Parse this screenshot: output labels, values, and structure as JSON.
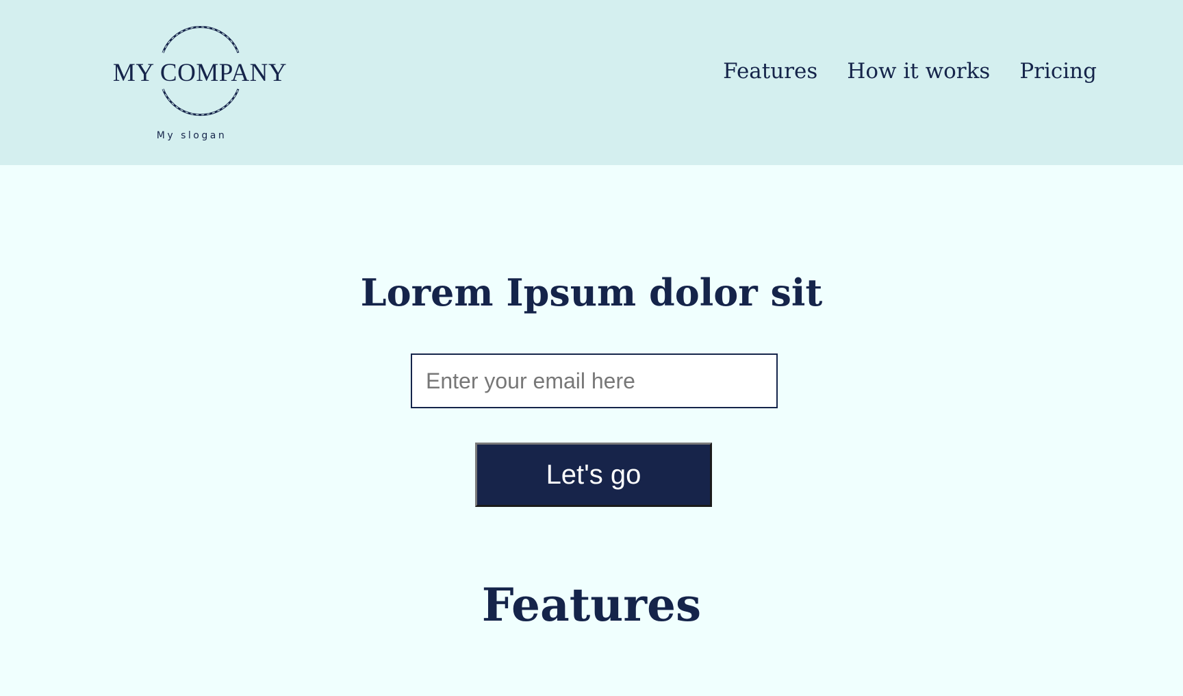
{
  "header": {
    "logo": {
      "company_name": "MY COMPANY",
      "slogan": "My slogan"
    },
    "nav": {
      "items": [
        {
          "label": "Features"
        },
        {
          "label": "How it works"
        },
        {
          "label": "Pricing"
        }
      ]
    }
  },
  "hero": {
    "title": "Lorem Ipsum dolor sit",
    "email_placeholder": "Enter your email here",
    "email_value": "",
    "cta_label": "Let's go"
  },
  "features": {
    "title": "Features"
  },
  "colors": {
    "header_bg": "#D4EFEF",
    "page_bg": "#F0FFFE",
    "primary": "#15244A",
    "button_text": "#FFFFFF"
  }
}
